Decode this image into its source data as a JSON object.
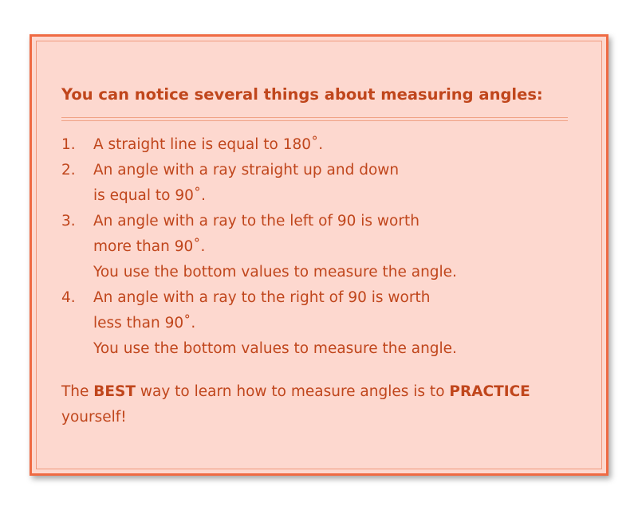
{
  "heading": "You can notice several things about measuring angles:",
  "items": [
    {
      "number": "1.",
      "lines": [
        "A straight line is equal to 180˚."
      ]
    },
    {
      "number": "2.",
      "lines": [
        "An angle with a ray straight up and down",
        "is equal to 90˚."
      ]
    },
    {
      "number": "3.",
      "lines": [
        "An angle with a ray to the left of 90 is worth",
        "more than 90˚.",
        "You use the bottom values to measure the angle."
      ]
    },
    {
      "number": "4.",
      "lines": [
        "An angle with a ray to the right of 90 is worth",
        "less than 90˚.",
        "You use the bottom values to measure the angle."
      ]
    }
  ],
  "closing": {
    "part1": "The ",
    "bold1": "BEST",
    "part2": " way to learn how to measure angles is to ",
    "bold2": "PRACTICE",
    "part3": "yourself!"
  }
}
